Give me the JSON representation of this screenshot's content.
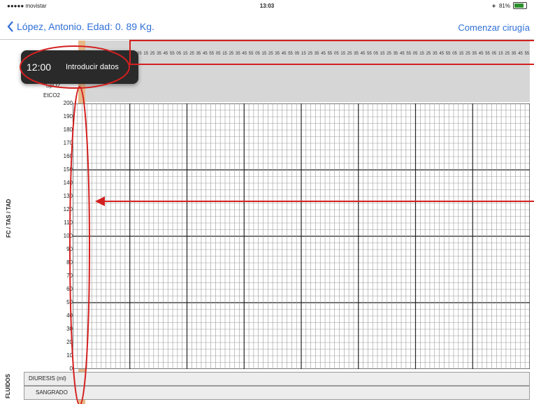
{
  "status_bar": {
    "carrier": "●●●●● movistar",
    "time": "13:03",
    "battery": "81%",
    "battery_level": 0.81
  },
  "nav": {
    "back_label": "López, Antonio. Edad: 0. 89 Kg.",
    "action_label": "Comenzar cirugía"
  },
  "tooltip": {
    "time": "12:00",
    "action": "Introducir datos"
  },
  "row_labels": {
    "spo2": "SpO2",
    "etco2": "EtCO2"
  },
  "axis_label": "FC / TAS / TAD",
  "y_ticks": [
    "200",
    "190",
    "180",
    "170",
    "160",
    "150",
    "140",
    "130",
    "120",
    "110",
    "100",
    "90",
    "80",
    "70",
    "60",
    "50",
    "40",
    "30",
    "20",
    "10",
    "0"
  ],
  "time_ruler": [
    "05",
    "15",
    "25",
    "35",
    "45",
    "55",
    "05",
    "15",
    "25",
    "35",
    "45",
    "55",
    "05",
    "15",
    "25",
    "35",
    "45",
    "55",
    "05",
    "15",
    "25",
    "35",
    "45",
    "55",
    "05",
    "15",
    "25",
    "35",
    "45",
    "55",
    "05",
    "15",
    "25",
    "35",
    "45",
    "55",
    "05",
    "15",
    "25",
    "35",
    "45",
    "55",
    "05",
    "15",
    "25",
    "35",
    "45",
    "55",
    "05",
    "15",
    "25",
    "35",
    "45",
    "55",
    "05",
    "15",
    "25",
    "35",
    "45",
    "55"
  ],
  "fluids": {
    "section_label": "FLUIDOS",
    "diuresis": "DIURESIS (ml)",
    "sangrado": "SANGRADO"
  },
  "colors": {
    "accent": "#2f6fd6",
    "annotation": "#d42020",
    "highlight": "#e7b98a",
    "grid_minor": "#9a9a9a",
    "grid_major": "#222222"
  }
}
